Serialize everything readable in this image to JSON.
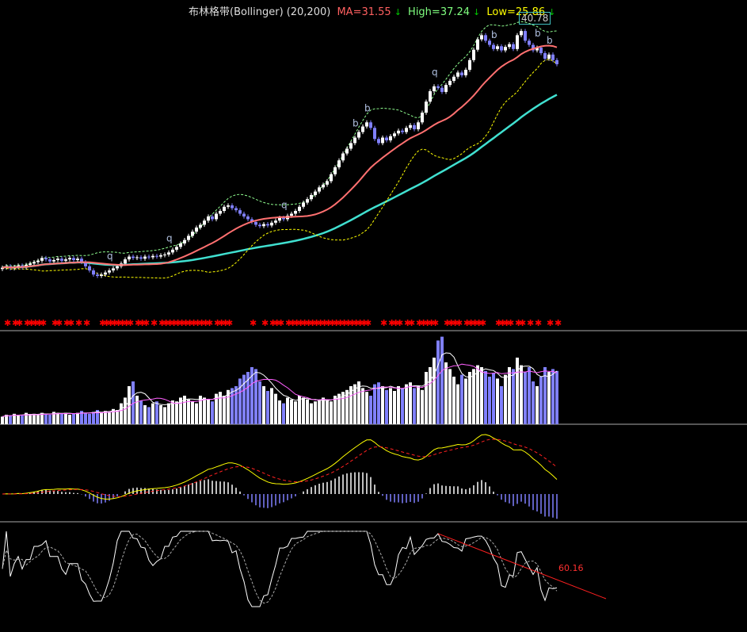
{
  "indicator_header": {
    "name": "布林格带(Bollinger)",
    "params": "(20,200)",
    "ma": "MA=31.55",
    "high": "High=37.24",
    "low": "Low=25.86",
    "arrow": "↓"
  },
  "max_price_label": "40.78",
  "trendline_label": "60.16",
  "colors": {
    "up": "#ffffff",
    "down": "#8080ff",
    "ma": "#ff7070",
    "upper_band": "#90ff90",
    "lower_band": "#ffff00",
    "long_ma": "#40e0d0",
    "signal": "#ff0000",
    "macd_dif": "#ffff00",
    "macd_dea": "#ff2020"
  },
  "chart_data": {
    "type": "candlestick",
    "close": [
      6.0,
      6.2,
      5.9,
      6.1,
      6.3,
      6.0,
      6.4,
      6.6,
      6.8,
      7.0,
      7.4,
      7.2,
      6.9,
      7.1,
      7.3,
      7.0,
      7.2,
      7.4,
      7.1,
      7.3,
      6.8,
      6.2,
      5.6,
      5.0,
      4.8,
      5.0,
      5.3,
      5.6,
      5.9,
      6.2,
      6.6,
      7.2,
      7.6,
      7.4,
      7.5,
      7.3,
      7.6,
      7.5,
      7.7,
      7.6,
      7.8,
      7.9,
      8.2,
      8.6,
      9.0,
      9.5,
      10.0,
      10.6,
      11.2,
      11.8,
      12.2,
      12.8,
      13.4,
      13.0,
      13.8,
      14.2,
      14.8,
      15.0,
      14.6,
      14.3,
      13.8,
      13.4,
      13.0,
      12.6,
      12.2,
      12.0,
      12.3,
      12.1,
      12.5,
      12.8,
      13.2,
      13.0,
      13.5,
      13.8,
      14.2,
      14.8,
      15.4,
      15.9,
      16.5,
      17.0,
      17.6,
      18.0,
      18.5,
      19.5,
      20.5,
      21.5,
      22.5,
      23.2,
      24.0,
      24.8,
      25.6,
      26.4,
      27.0,
      26.2,
      24.6,
      24.0,
      24.8,
      24.4,
      25.0,
      25.4,
      25.8,
      25.6,
      26.2,
      26.6,
      26.0,
      27.0,
      28.4,
      30.0,
      31.5,
      32.2,
      32.0,
      31.4,
      32.4,
      33.0,
      33.6,
      34.2,
      33.8,
      34.6,
      36.0,
      37.5,
      39.0,
      39.6,
      38.8,
      38.2,
      37.6,
      38.0,
      37.4,
      37.9,
      38.3,
      37.6,
      39.6,
      40.2,
      38.8,
      38.2,
      37.4,
      37.8,
      37.0,
      36.2,
      36.8,
      36.0,
      35.4
    ],
    "volume": [
      8,
      10,
      9,
      11,
      10,
      9,
      12,
      10,
      11,
      10,
      12,
      11,
      10,
      13,
      12,
      11,
      12,
      10,
      11,
      12,
      14,
      12,
      11,
      13,
      15,
      12,
      14,
      13,
      16,
      15,
      22,
      28,
      40,
      45,
      30,
      25,
      20,
      18,
      22,
      24,
      20,
      18,
      22,
      25,
      24,
      28,
      30,
      26,
      24,
      22,
      30,
      28,
      26,
      24,
      32,
      34,
      30,
      36,
      38,
      40,
      48,
      52,
      55,
      60,
      58,
      45,
      40,
      35,
      38,
      32,
      25,
      22,
      28,
      26,
      24,
      30,
      28,
      26,
      22,
      24,
      26,
      28,
      25,
      24,
      30,
      32,
      34,
      36,
      40,
      42,
      45,
      38,
      34,
      30,
      42,
      44,
      40,
      36,
      38,
      35,
      40,
      38,
      42,
      44,
      38,
      40,
      36,
      55,
      60,
      70,
      88,
      92,
      65,
      58,
      50,
      42,
      52,
      48,
      55,
      58,
      62,
      60,
      56,
      50,
      54,
      48,
      40,
      52,
      60,
      58,
      70,
      62,
      55,
      60,
      45,
      40,
      50,
      60,
      55,
      58,
      56
    ],
    "annotations": [
      {
        "index": 27,
        "text": "q"
      },
      {
        "index": 42,
        "text": "q"
      },
      {
        "index": 71,
        "text": "q"
      },
      {
        "index": 89,
        "text": "b"
      },
      {
        "index": 92,
        "text": "b"
      },
      {
        "index": 109,
        "text": "q"
      },
      {
        "index": 124,
        "text": "b"
      },
      {
        "index": 135,
        "text": "b"
      },
      {
        "index": 138,
        "text": "b"
      }
    ],
    "bollinger_period": 20,
    "long_ma_period": 60
  }
}
